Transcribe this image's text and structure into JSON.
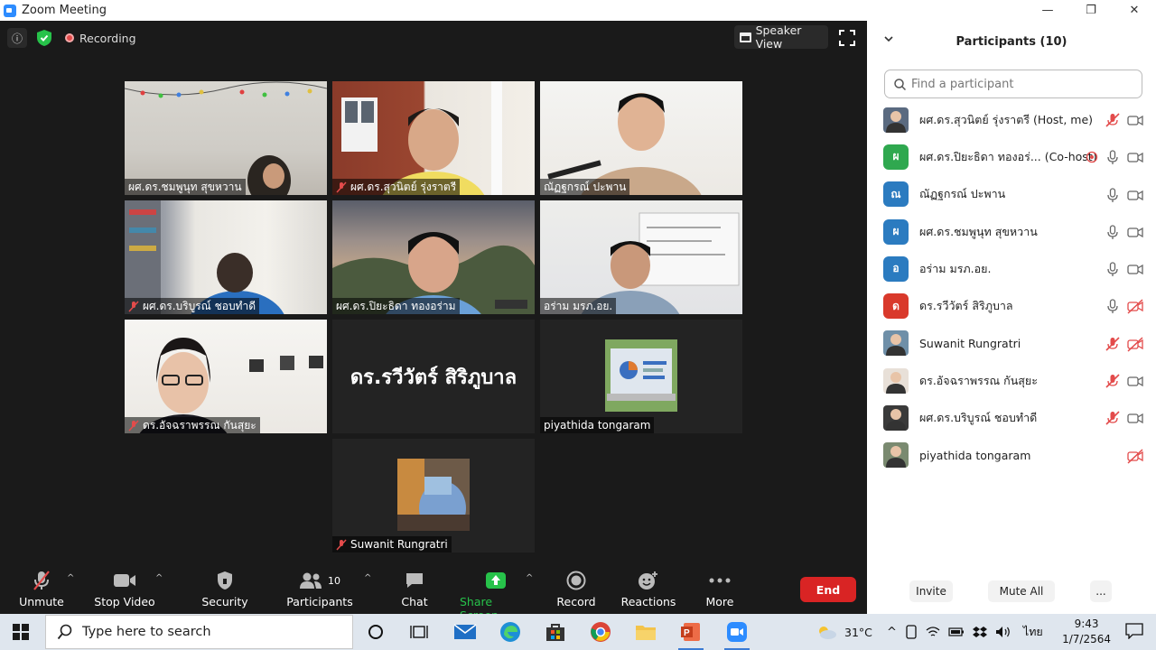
{
  "window": {
    "title": "Zoom Meeting",
    "minimize": "—",
    "maximize": "❐",
    "close": "✕"
  },
  "meeting": {
    "recording_label": "Recording",
    "view_label": "Speaker View",
    "tiles": [
      {
        "name": "ผศ.ดร.ชมพูนุท  สุขหวาน",
        "muted": false
      },
      {
        "name": "ผศ.ดร.สุวนิตย์ รุ่งราตรี",
        "muted": true
      },
      {
        "name": "ณัฏฐกรณ์ ปะพาน",
        "muted": false
      },
      {
        "name": "ผศ.ดร.บริบูรณ์ ชอบทำดี",
        "muted": true
      },
      {
        "name": "ผศ.ดร.ปิยะธิดา ทองอร่าม",
        "muted": false
      },
      {
        "name": "อร่าม มรภ.อย.",
        "muted": false
      },
      {
        "name": "ดร.อัจฉราพรรณ กันสุยะ",
        "muted": true
      },
      {
        "name": "ดร.รวีวัตร์ สิริภูบาล",
        "muted": false
      },
      {
        "name": "piyathida tongaram",
        "muted": false
      },
      {
        "name": "Suwanit Rungratri",
        "muted": true
      }
    ]
  },
  "toolbar": {
    "unmute": "Unmute",
    "stop_video": "Stop Video",
    "security": "Security",
    "participants": "Participants",
    "participants_count": "10",
    "chat": "Chat",
    "share_screen": "Share Screen",
    "record": "Record",
    "reactions": "Reactions",
    "more": "More",
    "end": "End"
  },
  "panel": {
    "title": "Participants (10)",
    "search_placeholder": "Find a participant",
    "participants": [
      {
        "name": "ผศ.ดร.สุวนิตย์ รุ่งราตรี (Host, me)",
        "avatar": "photo",
        "color": "#5a6a80",
        "mic": "muted",
        "video": "on"
      },
      {
        "name": "ผศ.ดร.ปิยะธิดา ทองอร่... (Co-host)",
        "avatar": "ผ",
        "color": "#2fa84f",
        "mic": "on",
        "video": "on",
        "sharing": true
      },
      {
        "name": "ณัฏฐกรณ์ ปะพาน",
        "avatar": "ณ",
        "color": "#2b7bc0",
        "mic": "on",
        "video": "on"
      },
      {
        "name": "ผศ.ดร.ชมพูนุท  สุขหวาน",
        "avatar": "ผ",
        "color": "#2b7bc0",
        "mic": "on",
        "video": "on"
      },
      {
        "name": "อร่าม มรภ.อย.",
        "avatar": "อ",
        "color": "#2b7bc0",
        "mic": "on",
        "video": "on"
      },
      {
        "name": "ดร.รวีวัตร์ สิริภูบาล",
        "avatar": "ด",
        "color": "#d9392b",
        "mic": "on",
        "video": "off"
      },
      {
        "name": "Suwanit Rungratri",
        "avatar": "photo",
        "color": "#6f8fa8",
        "mic": "muted",
        "video": "off"
      },
      {
        "name": "ดร.อัจฉราพรรณ กันสุยะ",
        "avatar": "photo",
        "color": "#e8e0d8",
        "mic": "muted",
        "video": "on"
      },
      {
        "name": "ผศ.ดร.บริบูรณ์ ชอบทำดี",
        "avatar": "photo",
        "color": "#3a3a3a",
        "mic": "muted",
        "video": "on"
      },
      {
        "name": "piyathida tongaram",
        "avatar": "photo",
        "color": "#7a8a70",
        "mic": "none",
        "video": "off"
      }
    ],
    "invite": "Invite",
    "mute_all": "Mute All",
    "more": "..."
  },
  "taskbar": {
    "search_placeholder": "Type here to search",
    "temperature": "31°C",
    "language": "ไทย",
    "time": "9:43",
    "date": "1/7/2564"
  },
  "colors": {
    "accent": "#2d8cff",
    "end": "#d92424",
    "share": "#27c24a",
    "active_speaker": "#b6e03a"
  }
}
